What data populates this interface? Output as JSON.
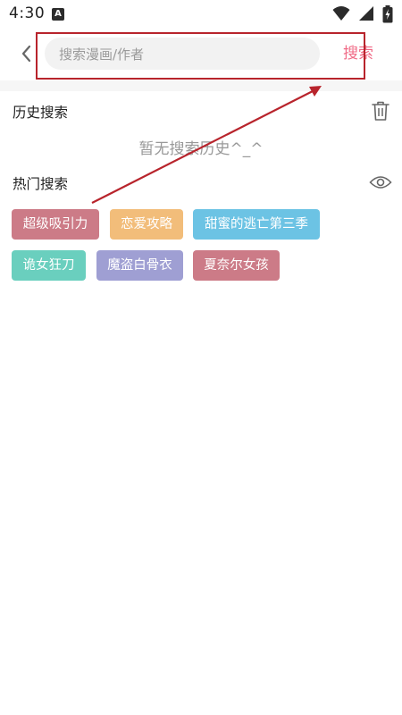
{
  "status_bar": {
    "time": "4:30",
    "notification_icon_letter": "A",
    "icons": [
      "wifi-icon",
      "signal-icon",
      "battery-charging-icon"
    ]
  },
  "header": {
    "back_icon": "chevron-left-icon",
    "search": {
      "placeholder": "搜索漫画/作者",
      "value": ""
    },
    "search_button_label": "搜索"
  },
  "history": {
    "title": "历史搜索",
    "clear_icon": "trash-icon",
    "empty_text": "暂无搜索历史^_^"
  },
  "hot": {
    "title": "热门搜索",
    "toggle_icon": "eye-icon",
    "tags": [
      {
        "label": "超级吸引力",
        "color": "#cc7b87"
      },
      {
        "label": "恋爱攻略",
        "color": "#f2bd7a"
      },
      {
        "label": "甜蜜的逃亡第三季",
        "color": "#6cc3e4"
      },
      {
        "label": "诡女狂刀",
        "color": "#6acfbe"
      },
      {
        "label": "魔盗白骨衣",
        "color": "#9f9fd3"
      },
      {
        "label": "夏奈尔女孩",
        "color": "#cc7b87"
      }
    ]
  },
  "colors": {
    "accent": "#f06a86",
    "annotation": "#b8242c"
  }
}
